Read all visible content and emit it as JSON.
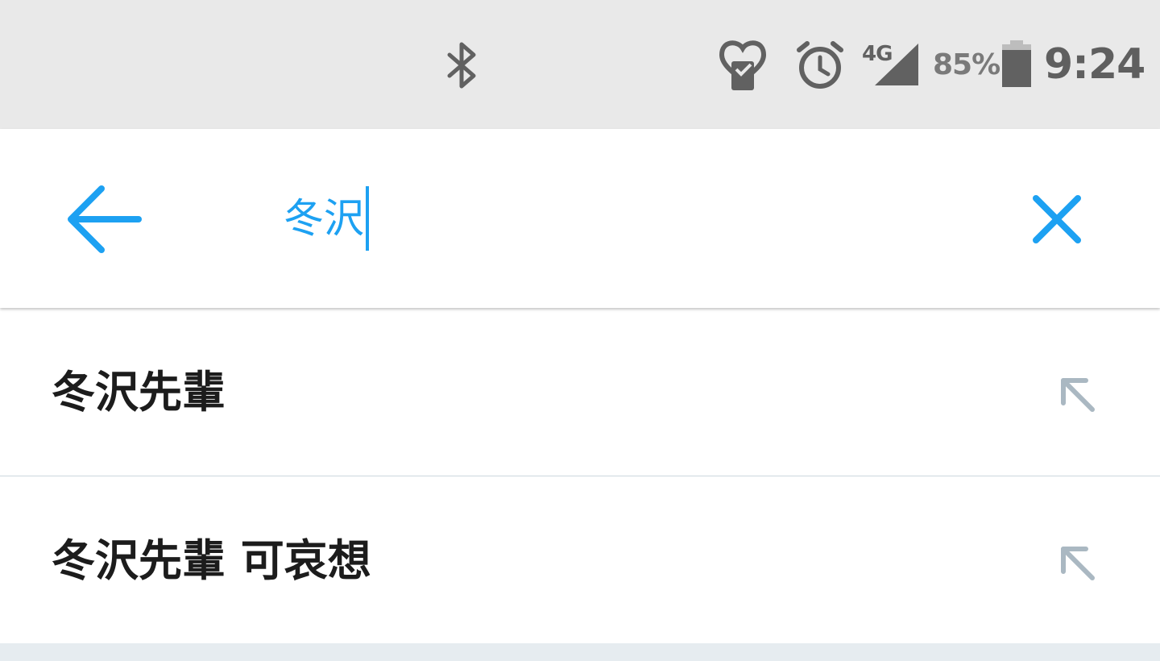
{
  "status_bar": {
    "icons": [
      "bluetooth-icon",
      "health-icon",
      "alarm-icon",
      "signal-icon",
      "battery-icon"
    ],
    "network_type": "4G",
    "battery_percent": "85%",
    "time": "9:24"
  },
  "search": {
    "query": "冬沢",
    "accent_color": "#1da1f2"
  },
  "suggestions": [
    {
      "text": "冬沢先輩"
    },
    {
      "text": "冬沢先輩 可哀想"
    }
  ]
}
